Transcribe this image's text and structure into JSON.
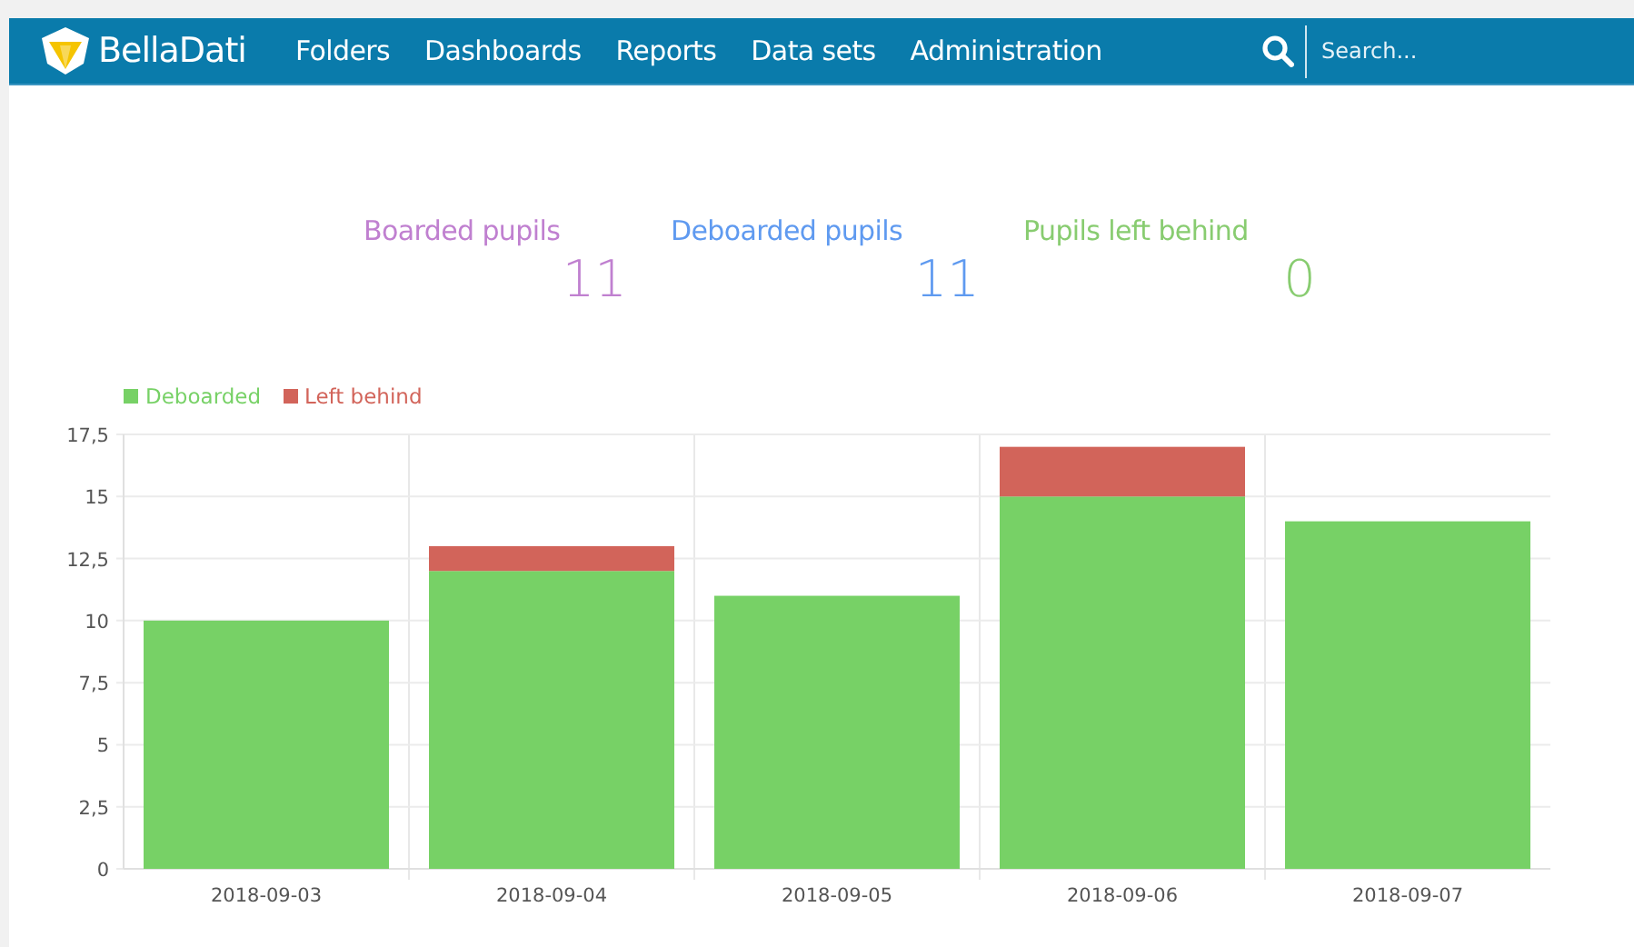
{
  "brand": "BellaDati",
  "nav": [
    {
      "label": "Folders"
    },
    {
      "label": "Dashboards"
    },
    {
      "label": "Reports"
    },
    {
      "label": "Data sets"
    },
    {
      "label": "Administration"
    }
  ],
  "search": {
    "placeholder": "Search..."
  },
  "kpis": [
    {
      "label": "Boarded pupils",
      "value": "11",
      "color": "#c080d0"
    },
    {
      "label": "Deboarded pupils",
      "value": "11",
      "color": "#5f9af0"
    },
    {
      "label": "Pupils left behind",
      "value": "0",
      "color": "#88cc70"
    }
  ],
  "chart": {
    "chart_data": {
      "type": "bar",
      "stacked": true,
      "grid": true,
      "categories": [
        "2018-09-03",
        "2018-09-04",
        "2018-09-05",
        "2018-09-06",
        "2018-09-07"
      ],
      "series": [
        {
          "name": "Deboarded",
          "color": "#77d166",
          "values": [
            10,
            12,
            11,
            15,
            14
          ]
        },
        {
          "name": "Left behind",
          "color": "#d2645a",
          "values": [
            0,
            1,
            0,
            2,
            0
          ]
        }
      ],
      "ylim": [
        0,
        17.5
      ],
      "yticks": [
        {
          "value": 0,
          "label": "0"
        },
        {
          "value": 2.5,
          "label": "2,5"
        },
        {
          "value": 5,
          "label": "5"
        },
        {
          "value": 7.5,
          "label": "7,5"
        },
        {
          "value": 10,
          "label": "10"
        },
        {
          "value": 12.5,
          "label": "12,5"
        },
        {
          "value": 15,
          "label": "15"
        },
        {
          "value": 17.5,
          "label": "17,5"
        }
      ]
    }
  }
}
